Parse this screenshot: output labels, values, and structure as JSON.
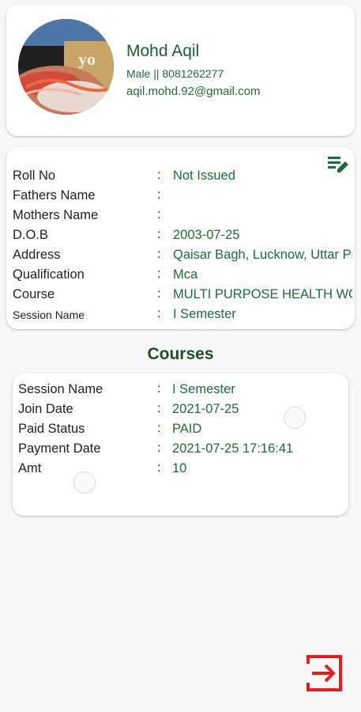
{
  "profile": {
    "name": "Mohd Aqil",
    "gender_phone": "Male || 8081262277",
    "email": "aqil.mohd.92@gmail.com"
  },
  "details": {
    "rows": [
      {
        "label": "Roll No",
        "value": "Not Issued"
      },
      {
        "label": "Fathers Name",
        "value": ""
      },
      {
        "label": "Mothers Name",
        "value": ""
      },
      {
        "label": "D.O.B",
        "value": "2003-07-25"
      },
      {
        "label": "Address",
        "value": "Qaisar Bagh, Lucknow, Uttar Pradesh"
      },
      {
        "label": "Qualification",
        "value": "Mca"
      },
      {
        "label": "Course",
        "value": "MULTI PURPOSE HEALTH WORKER"
      },
      {
        "label": "Session Name",
        "value": "I Semester"
      }
    ],
    "separator": ":"
  },
  "courses": {
    "heading": "Courses",
    "items": [
      {
        "rows": [
          {
            "label": "Session Name",
            "value": "I Semester"
          },
          {
            "label": "Join Date",
            "value": "2021-07-25"
          },
          {
            "label": "Paid Status",
            "value": "PAID"
          },
          {
            "label": "Payment Date",
            "value": "2021-07-25 17:16:41"
          },
          {
            "label": "Amt",
            "value": "10"
          }
        ]
      }
    ]
  },
  "icons": {
    "edit": "edit-list-icon",
    "logout": "logout-icon"
  },
  "colors": {
    "accent_green": "#1e6a3b",
    "heading_green": "#1e4d30",
    "logout_red": "#e02020"
  }
}
